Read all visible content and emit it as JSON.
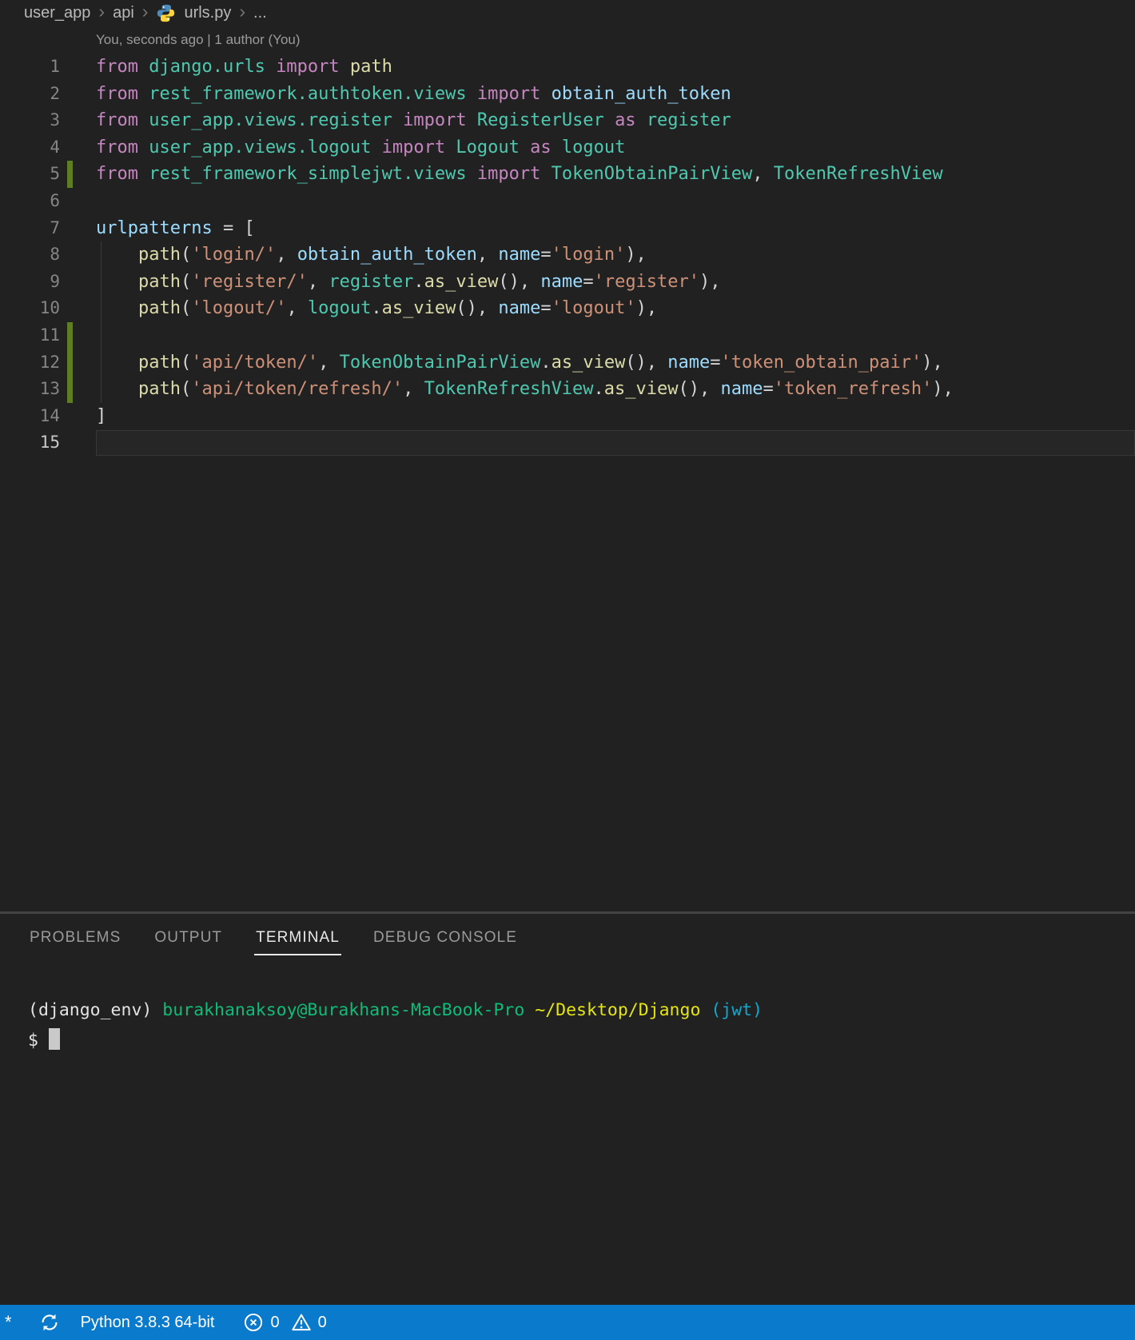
{
  "breadcrumbs": {
    "items": [
      {
        "label": "user_app"
      },
      {
        "label": "api"
      },
      {
        "label": "urls.py",
        "icon": "python-icon"
      },
      {
        "label": "..."
      }
    ]
  },
  "editor": {
    "codelens": "You, seconds ago | 1 author (You)",
    "lines": [
      {
        "num": "1",
        "added": false,
        "guide": false,
        "current": false,
        "tokens": [
          [
            "kw",
            "from"
          ],
          [
            "pun",
            " "
          ],
          [
            "mod",
            "django.urls"
          ],
          [
            "pun",
            " "
          ],
          [
            "kw",
            "import"
          ],
          [
            "pun",
            " "
          ],
          [
            "fn",
            "path"
          ]
        ]
      },
      {
        "num": "2",
        "added": false,
        "guide": false,
        "current": false,
        "tokens": [
          [
            "kw",
            "from"
          ],
          [
            "pun",
            " "
          ],
          [
            "mod",
            "rest_framework.authtoken.views"
          ],
          [
            "pun",
            " "
          ],
          [
            "kw",
            "import"
          ],
          [
            "pun",
            " "
          ],
          [
            "var",
            "obtain_auth_token"
          ]
        ]
      },
      {
        "num": "3",
        "added": false,
        "guide": false,
        "current": false,
        "tokens": [
          [
            "kw",
            "from"
          ],
          [
            "pun",
            " "
          ],
          [
            "mod",
            "user_app.views.register"
          ],
          [
            "pun",
            " "
          ],
          [
            "kw",
            "import"
          ],
          [
            "pun",
            " "
          ],
          [
            "mod",
            "RegisterUser"
          ],
          [
            "pun",
            " "
          ],
          [
            "kw",
            "as"
          ],
          [
            "pun",
            " "
          ],
          [
            "mod",
            "register"
          ]
        ]
      },
      {
        "num": "4",
        "added": false,
        "guide": false,
        "current": false,
        "tokens": [
          [
            "kw",
            "from"
          ],
          [
            "pun",
            " "
          ],
          [
            "mod",
            "user_app.views.logout"
          ],
          [
            "pun",
            " "
          ],
          [
            "kw",
            "import"
          ],
          [
            "pun",
            " "
          ],
          [
            "mod",
            "Logout"
          ],
          [
            "pun",
            " "
          ],
          [
            "kw",
            "as"
          ],
          [
            "pun",
            " "
          ],
          [
            "mod",
            "logout"
          ]
        ]
      },
      {
        "num": "5",
        "added": true,
        "guide": false,
        "current": false,
        "tokens": [
          [
            "kw",
            "from"
          ],
          [
            "pun",
            " "
          ],
          [
            "mod",
            "rest_framework_simplejwt.views"
          ],
          [
            "pun",
            " "
          ],
          [
            "kw",
            "import"
          ],
          [
            "pun",
            " "
          ],
          [
            "mod",
            "TokenObtainPairView"
          ],
          [
            "pun",
            ", "
          ],
          [
            "mod",
            "TokenRefreshView"
          ]
        ]
      },
      {
        "num": "6",
        "added": false,
        "guide": false,
        "current": false,
        "tokens": []
      },
      {
        "num": "7",
        "added": false,
        "guide": false,
        "current": false,
        "tokens": [
          [
            "var",
            "urlpatterns"
          ],
          [
            "pun",
            " = ["
          ]
        ]
      },
      {
        "num": "8",
        "added": false,
        "guide": true,
        "current": false,
        "tokens": [
          [
            "pun",
            "    "
          ],
          [
            "fn",
            "path"
          ],
          [
            "pun",
            "("
          ],
          [
            "str",
            "'login/'"
          ],
          [
            "pun",
            ", "
          ],
          [
            "var",
            "obtain_auth_token"
          ],
          [
            "pun",
            ", "
          ],
          [
            "var",
            "name"
          ],
          [
            "pun",
            "="
          ],
          [
            "str",
            "'login'"
          ],
          [
            "pun",
            "),"
          ]
        ]
      },
      {
        "num": "9",
        "added": false,
        "guide": true,
        "current": false,
        "tokens": [
          [
            "pun",
            "    "
          ],
          [
            "fn",
            "path"
          ],
          [
            "pun",
            "("
          ],
          [
            "str",
            "'register/'"
          ],
          [
            "pun",
            ", "
          ],
          [
            "mod",
            "register"
          ],
          [
            "pun",
            "."
          ],
          [
            "fn",
            "as_view"
          ],
          [
            "pun",
            "(), "
          ],
          [
            "var",
            "name"
          ],
          [
            "pun",
            "="
          ],
          [
            "str",
            "'register'"
          ],
          [
            "pun",
            "),"
          ]
        ]
      },
      {
        "num": "10",
        "added": false,
        "guide": true,
        "current": false,
        "tokens": [
          [
            "pun",
            "    "
          ],
          [
            "fn",
            "path"
          ],
          [
            "pun",
            "("
          ],
          [
            "str",
            "'logout/'"
          ],
          [
            "pun",
            ", "
          ],
          [
            "mod",
            "logout"
          ],
          [
            "pun",
            "."
          ],
          [
            "fn",
            "as_view"
          ],
          [
            "pun",
            "(), "
          ],
          [
            "var",
            "name"
          ],
          [
            "pun",
            "="
          ],
          [
            "str",
            "'logout'"
          ],
          [
            "pun",
            "),"
          ]
        ]
      },
      {
        "num": "11",
        "added": true,
        "guide": true,
        "current": false,
        "tokens": []
      },
      {
        "num": "12",
        "added": true,
        "guide": true,
        "current": false,
        "tokens": [
          [
            "pun",
            "    "
          ],
          [
            "fn",
            "path"
          ],
          [
            "pun",
            "("
          ],
          [
            "str",
            "'api/token/'"
          ],
          [
            "pun",
            ", "
          ],
          [
            "mod",
            "TokenObtainPairView"
          ],
          [
            "pun",
            "."
          ],
          [
            "fn",
            "as_view"
          ],
          [
            "pun",
            "(), "
          ],
          [
            "var",
            "name"
          ],
          [
            "pun",
            "="
          ],
          [
            "str",
            "'token_obtain_pair'"
          ],
          [
            "pun",
            "),"
          ]
        ]
      },
      {
        "num": "13",
        "added": true,
        "guide": true,
        "current": false,
        "tokens": [
          [
            "pun",
            "    "
          ],
          [
            "fn",
            "path"
          ],
          [
            "pun",
            "("
          ],
          [
            "str",
            "'api/token/refresh/'"
          ],
          [
            "pun",
            ", "
          ],
          [
            "mod",
            "TokenRefreshView"
          ],
          [
            "pun",
            "."
          ],
          [
            "fn",
            "as_view"
          ],
          [
            "pun",
            "(), "
          ],
          [
            "var",
            "name"
          ],
          [
            "pun",
            "="
          ],
          [
            "str",
            "'token_refresh'"
          ],
          [
            "pun",
            "),"
          ]
        ]
      },
      {
        "num": "14",
        "added": false,
        "guide": false,
        "current": false,
        "tokens": [
          [
            "pun",
            "]"
          ]
        ]
      },
      {
        "num": "15",
        "added": false,
        "guide": false,
        "current": true,
        "tokens": []
      }
    ]
  },
  "panel": {
    "tabs": [
      {
        "label": "PROBLEMS",
        "active": false
      },
      {
        "label": "OUTPUT",
        "active": false
      },
      {
        "label": "TERMINAL",
        "active": true
      },
      {
        "label": "DEBUG CONSOLE",
        "active": false
      }
    ]
  },
  "terminal": {
    "line1": [
      {
        "color": "white",
        "text": "(django_env) "
      },
      {
        "color": "green",
        "text": "burakhanaksoy@Burakhans-MacBook-Pro "
      },
      {
        "color": "yellow",
        "text": "~/Desktop/Django "
      },
      {
        "color": "cyan",
        "text": "(jwt)"
      }
    ],
    "prompt": "$",
    "cursor_visible": true
  },
  "status_bar": {
    "left_indicator": "*",
    "interpreter": "Python 3.8.3 64-bit",
    "error_count": "0",
    "warning_count": "0"
  },
  "colors": {
    "background": "#212121",
    "keyword": "#C586C0",
    "module": "#4EC9B0",
    "function": "#DCDCAA",
    "variable": "#9CDCFE",
    "string": "#CE9178",
    "punctuation": "#D4D4D4",
    "added_gutter": "#5f7d23",
    "statusbar_bg": "#0a7acc",
    "terminal_green": "#0DBC79",
    "terminal_yellow": "#E5E510",
    "terminal_cyan": "#11A8CD"
  }
}
